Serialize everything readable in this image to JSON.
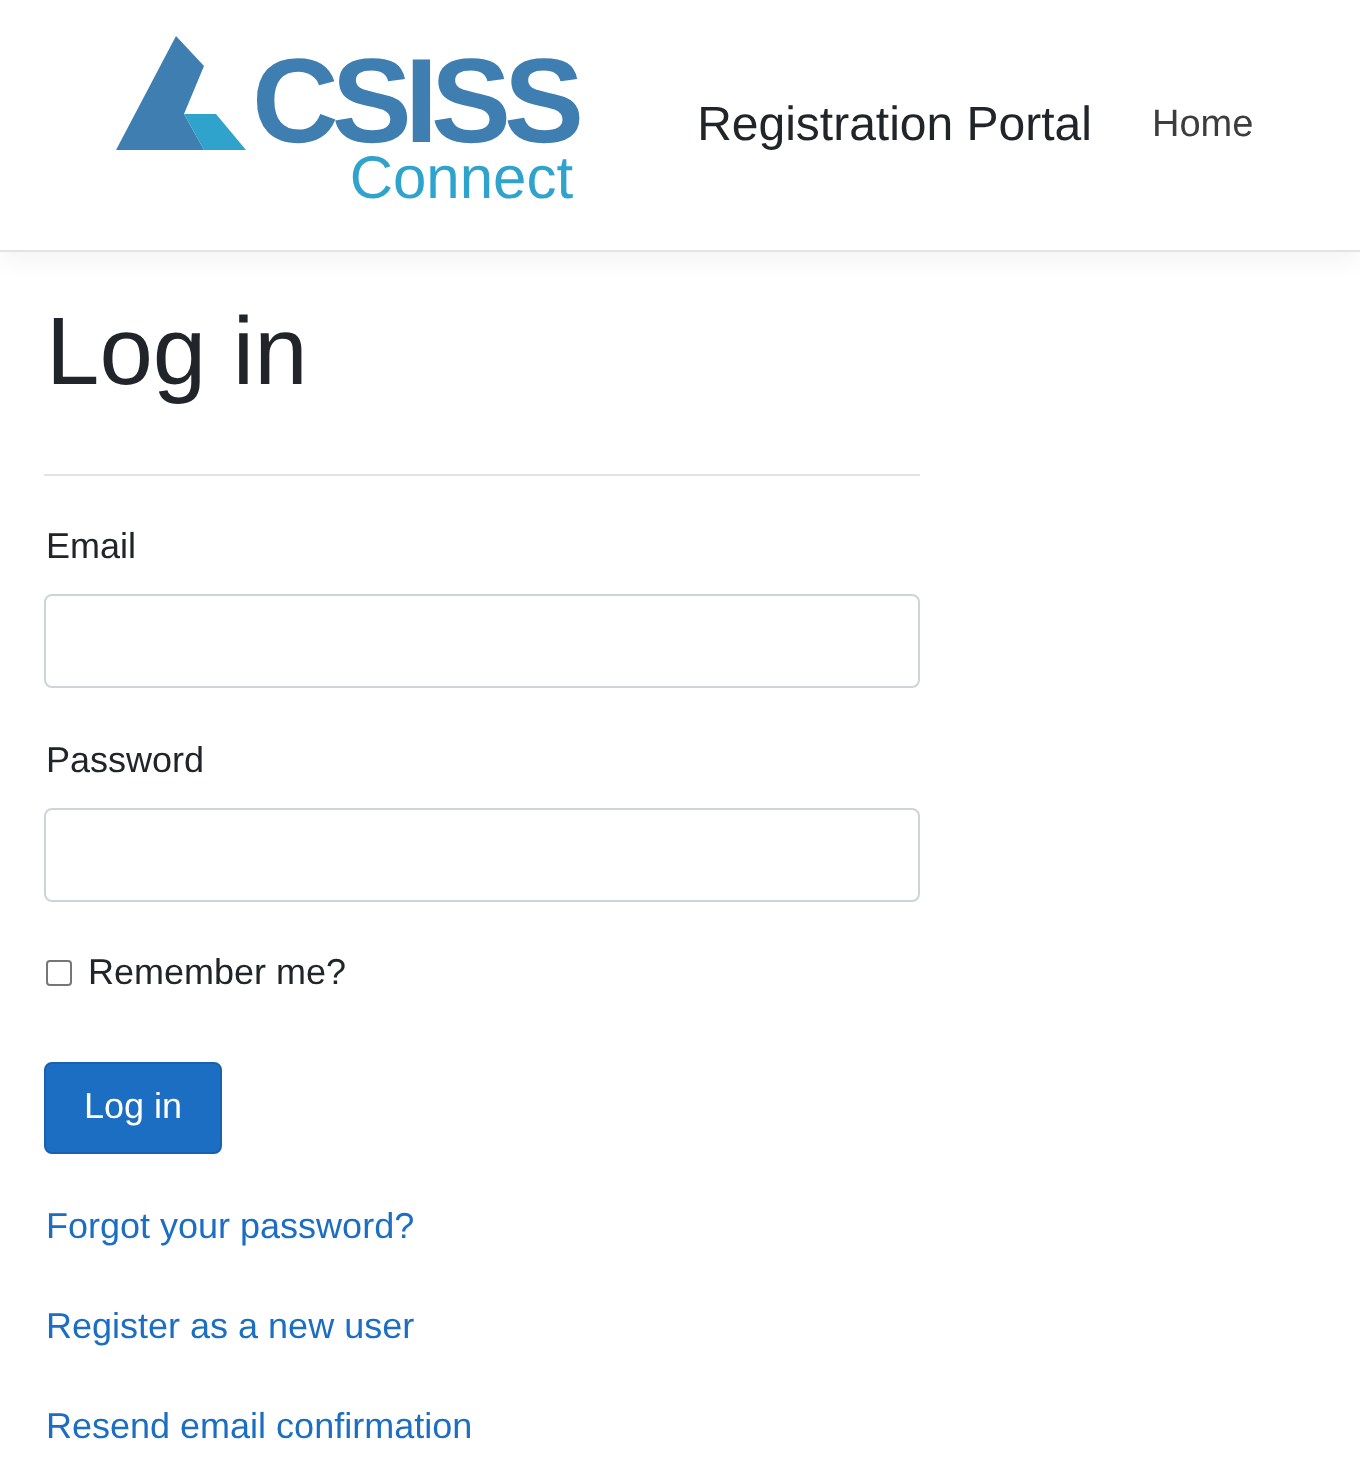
{
  "header": {
    "logo": {
      "wordmark": "CSISS",
      "tagline": "Connect"
    },
    "brand": "Registration Portal",
    "nav": [
      {
        "label": "Home"
      }
    ]
  },
  "login": {
    "title": "Log in",
    "fields": [
      {
        "label": "Email"
      },
      {
        "label": "Password"
      }
    ],
    "remember": {
      "label": "Remember me?",
      "checked": false
    },
    "submit": "Log in",
    "links": [
      "Forgot your password?",
      "Register as a new user",
      "Resend email confirmation"
    ]
  }
}
